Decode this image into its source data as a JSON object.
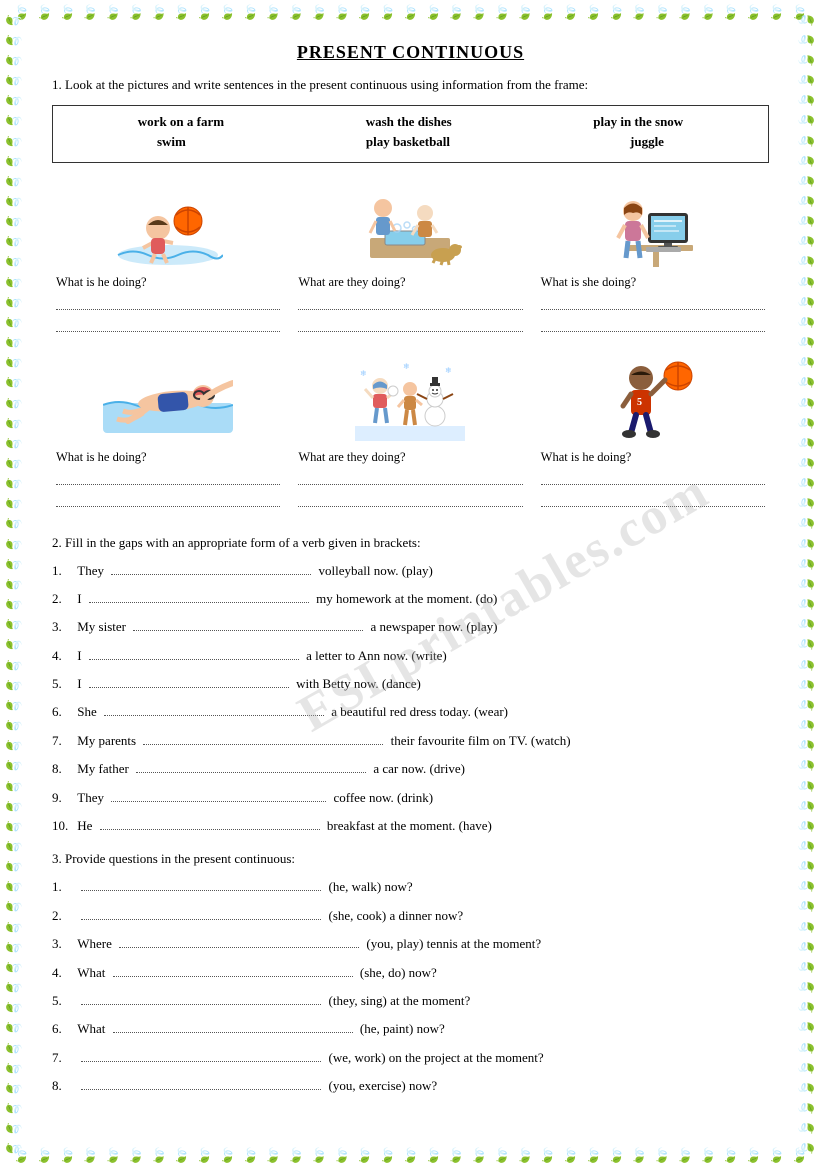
{
  "title": "PRESENT CONTINUOUS",
  "section1": {
    "instruction": "1. Look at the pictures and write sentences in the present continuous using information from the frame:",
    "vocab": {
      "row1": [
        "work on a farm",
        "wash the dishes",
        "play in the snow"
      ],
      "row2": [
        "swim",
        "play basketball",
        "juggle"
      ]
    },
    "pictures": [
      {
        "question": "What is he doing?",
        "type": "swim-ball"
      },
      {
        "question": "What are they doing?",
        "type": "wash-dishes"
      },
      {
        "question": "What is she doing?",
        "type": "computer"
      },
      {
        "question": "What is he doing?",
        "type": "swimmer"
      },
      {
        "question": "What are they doing?",
        "type": "snow"
      },
      {
        "question": "What is he doing?",
        "type": "basketball"
      }
    ]
  },
  "section2": {
    "instruction": "2. Fill in the gaps with an appropriate form of a verb given in brackets:",
    "items": [
      {
        "num": "1.",
        "before": "They",
        "dots": true,
        "after": "volleyball now. (play)"
      },
      {
        "num": "2.",
        "before": "I",
        "dots": true,
        "after": "my homework at the moment. (do)"
      },
      {
        "num": "3.",
        "before": "My sister",
        "dots": true,
        "after": "a newspaper now. (play)"
      },
      {
        "num": "4.",
        "before": "I",
        "dots": true,
        "after": "a letter to Ann now. (write)"
      },
      {
        "num": "5.",
        "before": "I",
        "dots": true,
        "after": "with Betty now. (dance)"
      },
      {
        "num": "6.",
        "before": "She",
        "dots": true,
        "after": "a beautiful red dress today. (wear)"
      },
      {
        "num": "7.",
        "before": "My parents",
        "dots": true,
        "after": "their favourite film on TV. (watch)"
      },
      {
        "num": "8.",
        "before": "My father",
        "dots": true,
        "after": "a car now. (drive)"
      },
      {
        "num": "9.",
        "before": "They",
        "dots": true,
        "after": "coffee now. (drink)"
      },
      {
        "num": "10.",
        "before": "He",
        "dots": true,
        "after": "breakfast at the moment. (have)"
      }
    ]
  },
  "section3": {
    "instruction": "3. Provide questions in the present continuous:",
    "items": [
      {
        "num": "1.",
        "before": "",
        "bracket": "(he, walk)",
        "after": "now?"
      },
      {
        "num": "2.",
        "before": "",
        "bracket": "(she, cook)",
        "after": "a dinner now?"
      },
      {
        "num": "3.",
        "before": "Where",
        "bracket": "(you, play)",
        "after": "tennis at the moment?"
      },
      {
        "num": "4.",
        "before": "What",
        "bracket": "(she, do)",
        "after": "now?"
      },
      {
        "num": "5.",
        "before": "",
        "bracket": "(they, sing)",
        "after": "at the moment?"
      },
      {
        "num": "6.",
        "before": "What",
        "bracket": "(he, paint)",
        "after": "now?"
      },
      {
        "num": "7.",
        "before": "",
        "bracket": "(we, work)",
        "after": "on the project at the moment?"
      },
      {
        "num": "8.",
        "before": "",
        "bracket": "(you, exercise)",
        "after": "now?"
      }
    ]
  },
  "watermark": "ESLprintables.com"
}
